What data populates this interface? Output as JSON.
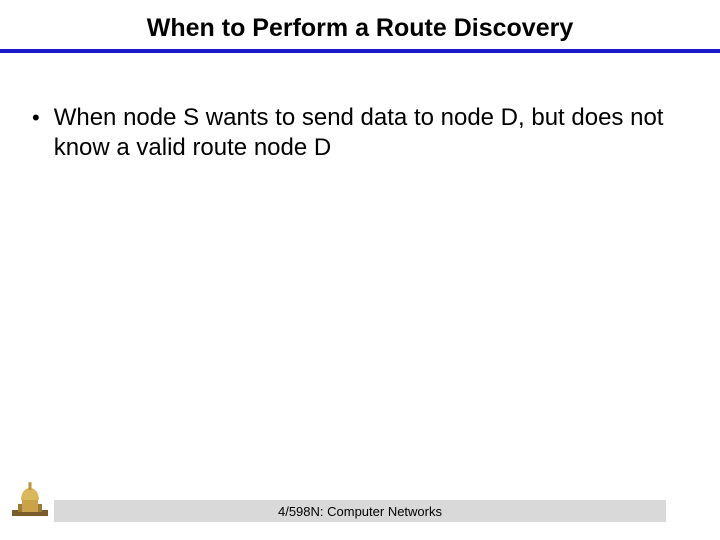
{
  "title": "When to Perform a Route Discovery",
  "bullets": [
    "When node S wants to send data to node D, but does not know a valid route node D"
  ],
  "footer": "4/598N: Computer Networks"
}
